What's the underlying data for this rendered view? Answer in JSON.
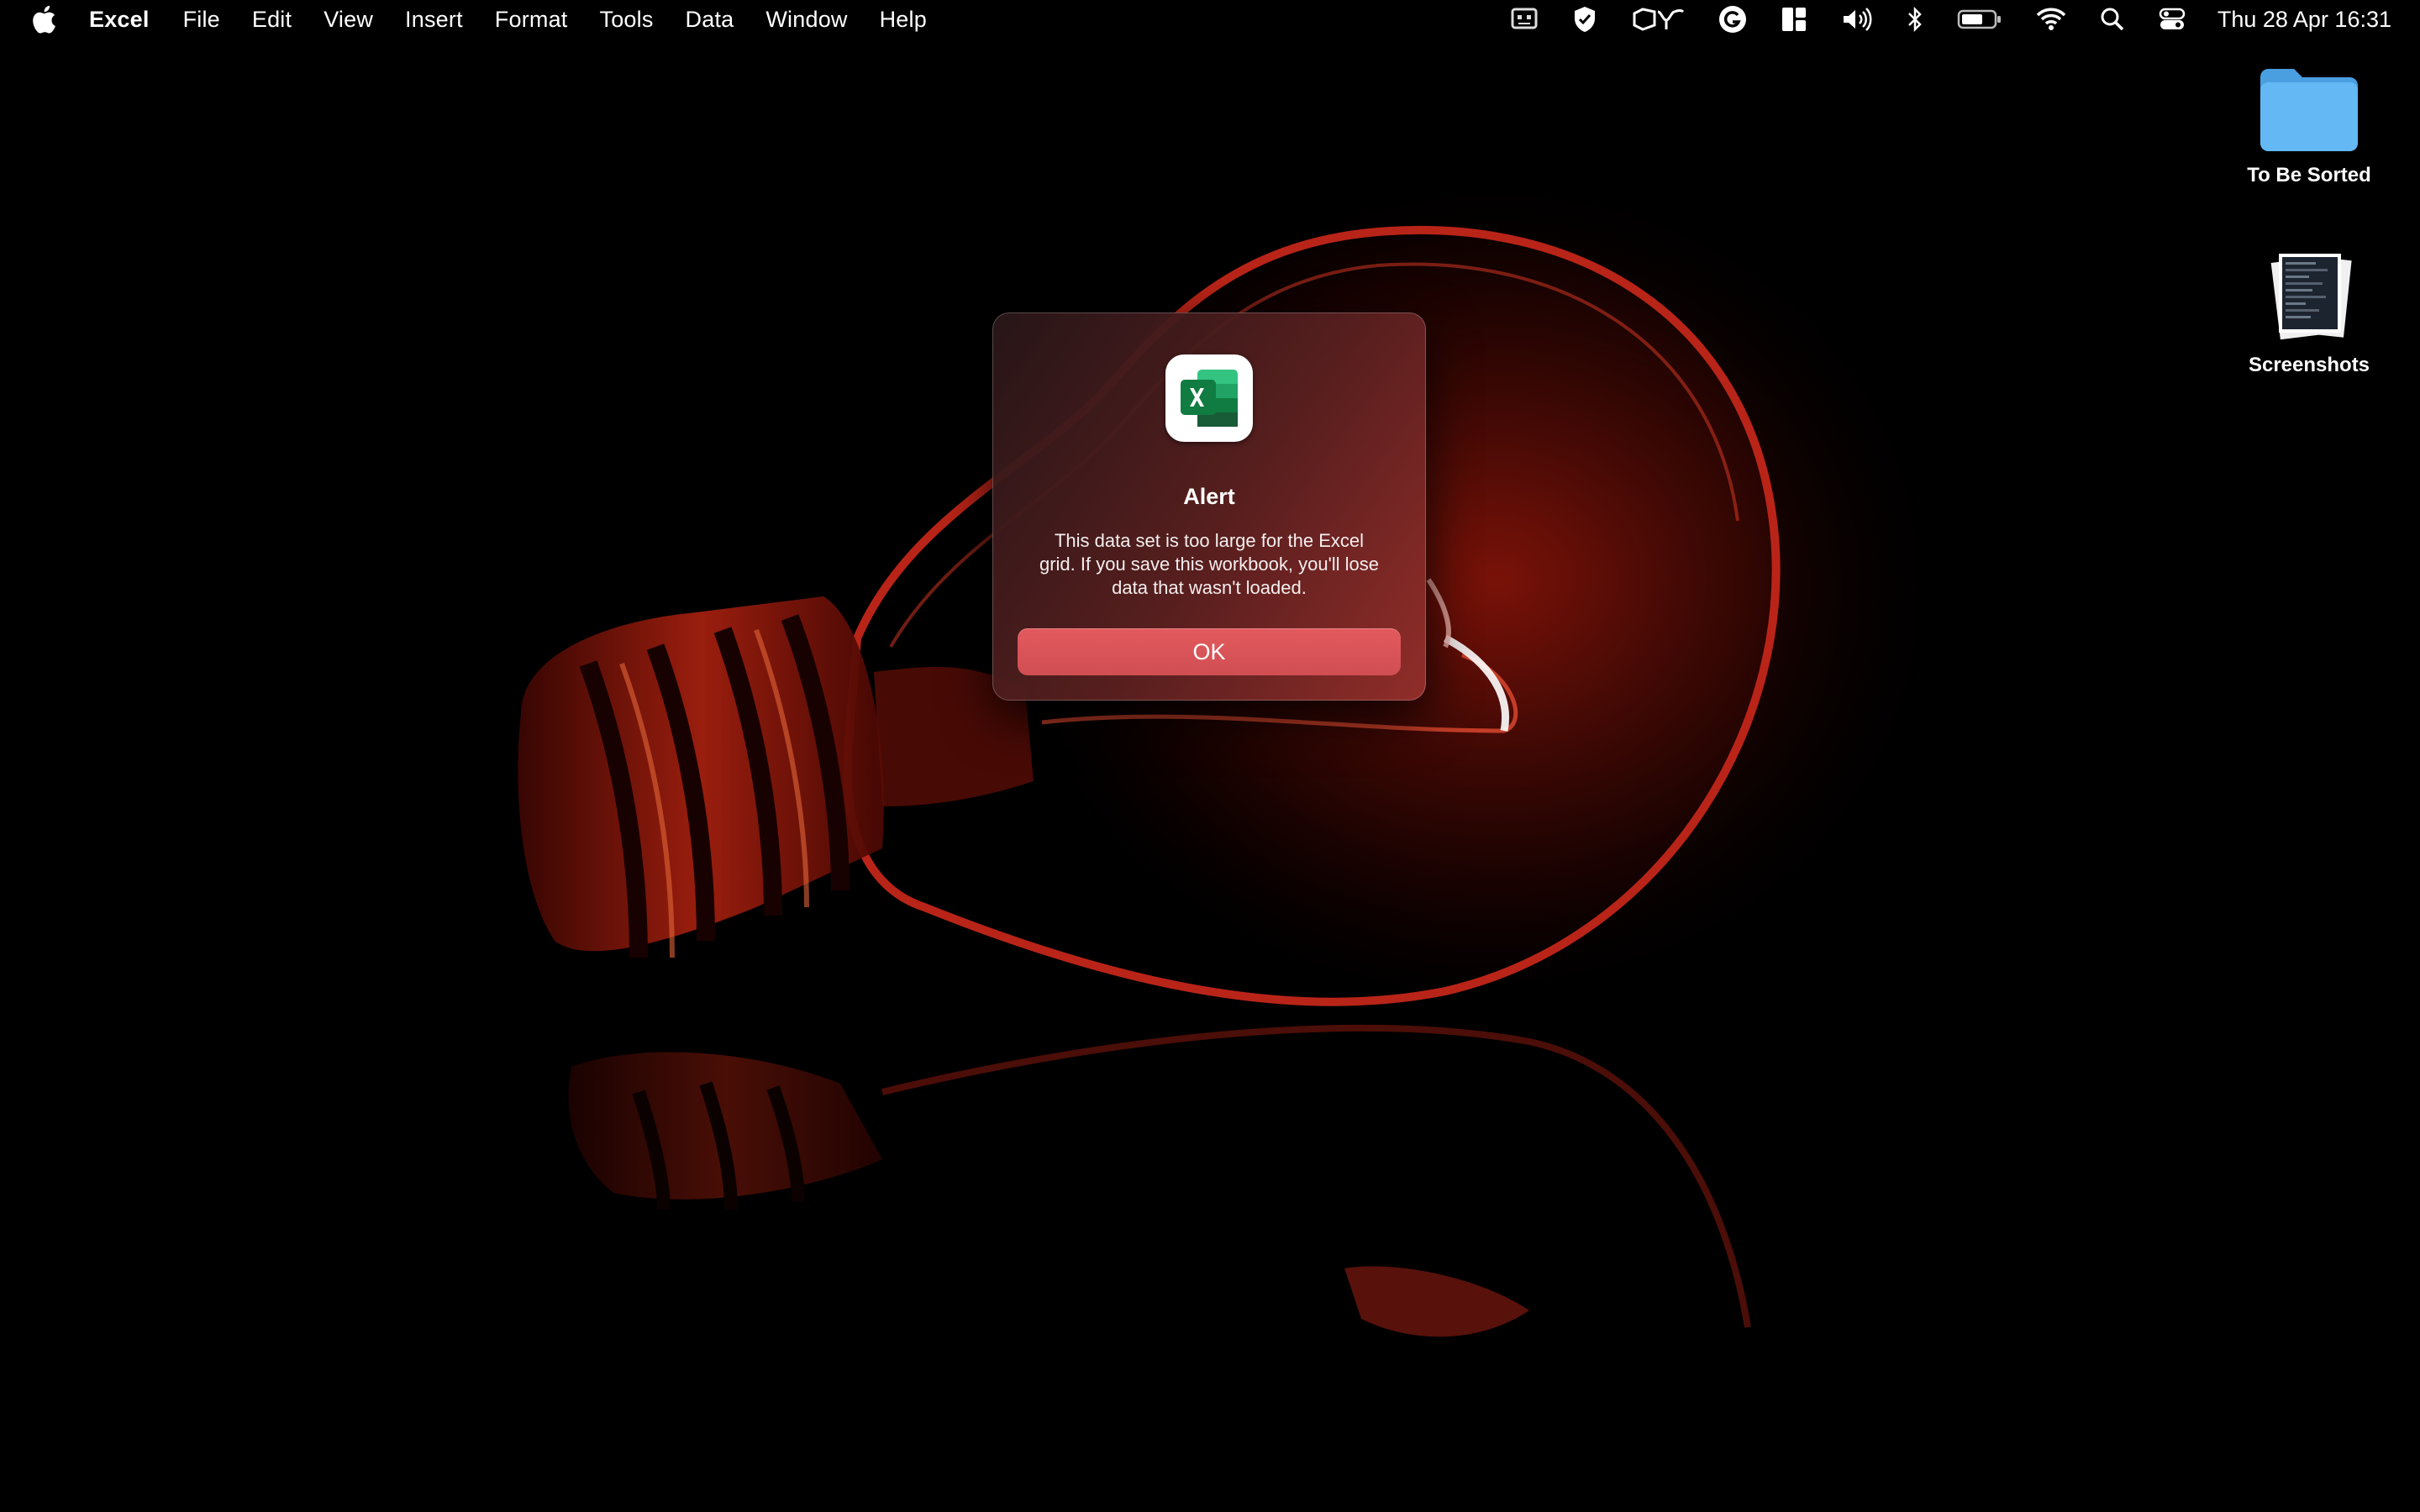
{
  "menubar": {
    "apple_icon": "apple-logo-icon",
    "app_name": "Excel",
    "items": [
      "File",
      "Edit",
      "View",
      "Insert",
      "Format",
      "Tools",
      "Data",
      "Window",
      "Help"
    ],
    "status_icons": [
      "robot-face-icon",
      "shield-check-icon",
      "vpn-shapes-icon",
      "grammarly-g-icon",
      "window-tiling-icon",
      "volume-icon",
      "bluetooth-icon",
      "battery-icon",
      "wifi-icon",
      "spotlight-search-icon",
      "control-center-icon"
    ],
    "clock": "Thu 28 Apr  16:31"
  },
  "desktop": {
    "icons": [
      {
        "label": "To Be Sorted",
        "icon": "folder-icon"
      },
      {
        "label": "Screenshots",
        "icon": "screenshots-stack-icon"
      }
    ]
  },
  "dialog": {
    "app_icon": "excel-app-icon",
    "title": "Alert",
    "message": "This data set is too large for the Excel grid.  If you save this workbook, you'll lose data that wasn't loaded.",
    "ok_label": "OK"
  },
  "colors": {
    "button": "#d9555a",
    "folder": "#5fb3f0",
    "excel_green": "#1d7044",
    "wallpaper_red": "#c3261a"
  }
}
